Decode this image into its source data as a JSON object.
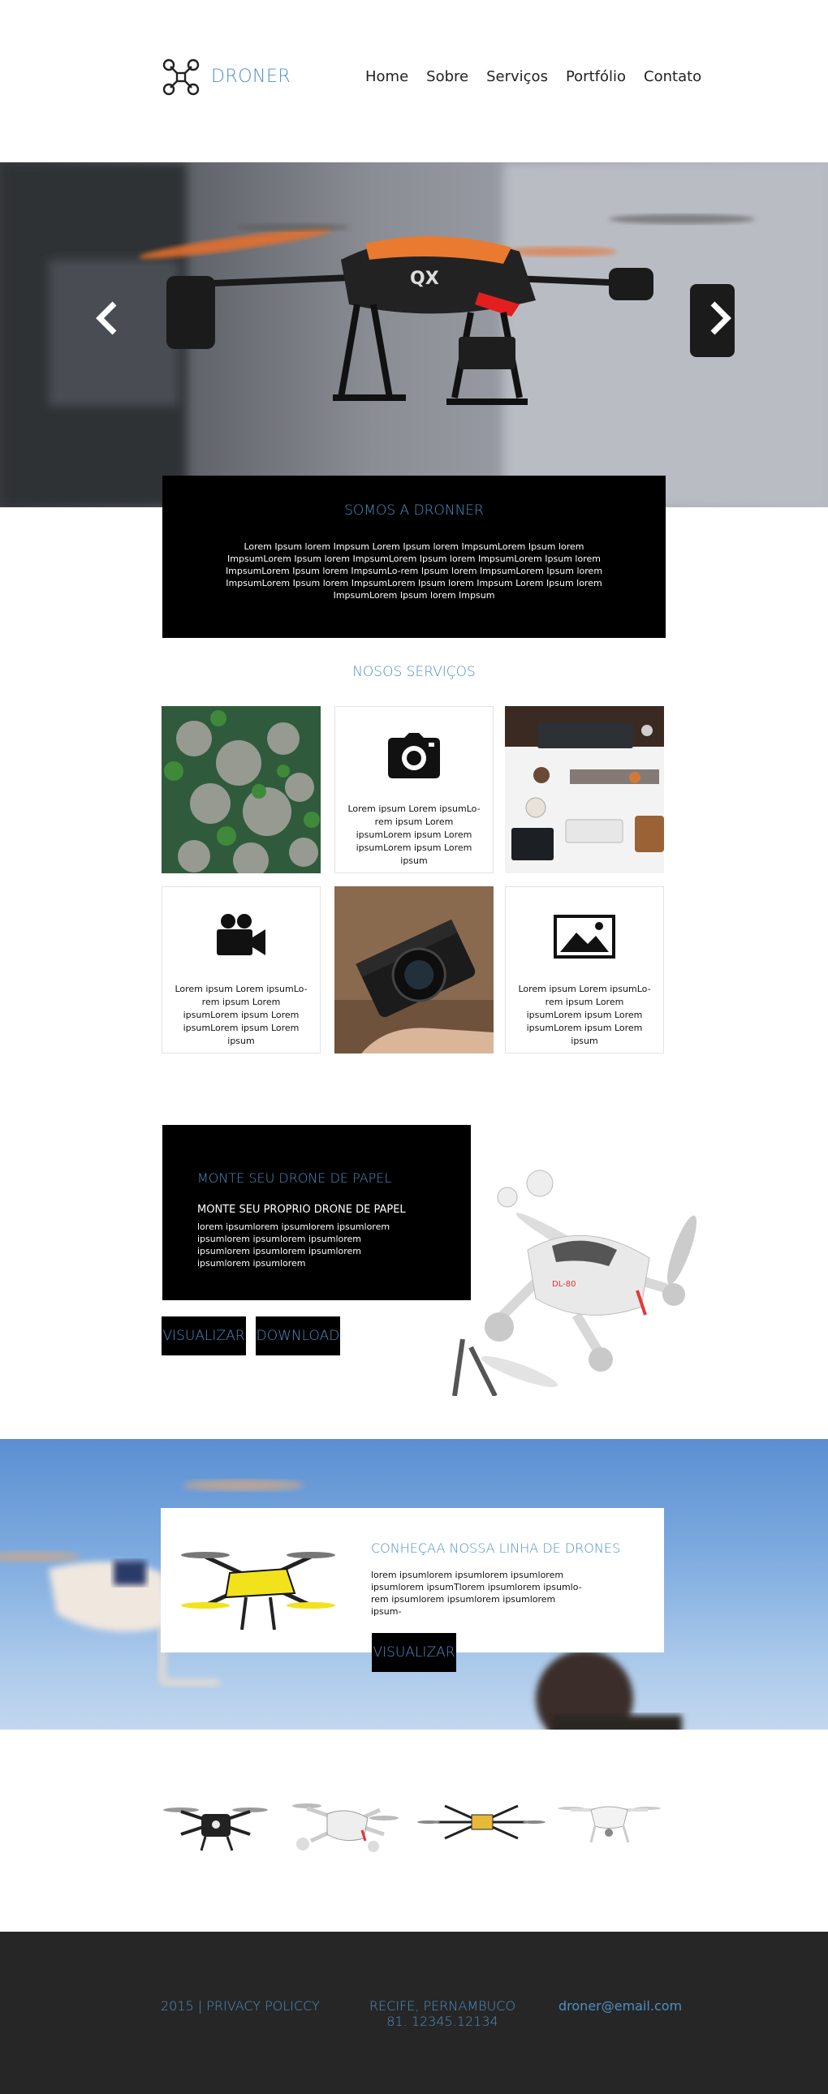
{
  "header": {
    "brand": "DRONER",
    "nav": [
      "Home",
      "Sobre",
      "Serviços",
      "Portfólio",
      "Contato"
    ]
  },
  "about": {
    "title": "SOMOS A DRONNER",
    "text": "Lorem Ipsum lorem Impsum Lorem Ipsum lorem ImpsumLorem Ipsum lorem ImpsumLorem Ipsum lorem ImpsumLorem Ipsum lorem ImpsumLorem Ipsum lorem ImpsumLorem Ipsum lorem ImpsumLo-rem Ipsum lorem ImpsumLorem Ipsum lorem ImpsumLorem Ipsum lorem ImpsumLorem Ipsum lorem Impsum Lorem Ipsum lorem ImpsumLorem Ipsum lorem Impsum"
  },
  "services": {
    "title": "NOSOS SERVIÇOS",
    "tiles": [
      {
        "icon": "camera-icon",
        "text": "Lorem ipsum Lorem ipsumLo-rem ipsum Lorem ipsumLorem ipsum Lorem ipsumLorem ipsum Lorem ipsum"
      },
      {
        "icon": "video-camera-icon",
        "text": "Lorem ipsum Lorem ipsumLo-rem ipsum Lorem ipsumLorem ipsum Lorem ipsumLorem ipsum Lorem ipsum"
      },
      {
        "icon": "image-icon",
        "text": "Lorem ipsum Lorem ipsumLo-rem ipsum Lorem ipsumLorem ipsum Lorem ipsumLorem ipsum Lorem ipsum"
      }
    ]
  },
  "paper": {
    "title": "MONTE SEU DRONE DE PAPEL",
    "subtitle": "MONTE SEU PROPRIO DRONE DE PAPEL",
    "text": "lorem ipsumlorem ipsumlorem ipsumlorem ipsumlorem ipsumlorem ipsumlorem ipsumlorem ipsumlorem ipsumlorem ipsumlorem ipsumlorem",
    "btn_view": "VISUALIZAR",
    "btn_download": "DOWNLOAD"
  },
  "line": {
    "title": "CONHEÇAA NOSSA LINHA DE DRONES",
    "text": "lorem ipsumlorem ipsumlorem ipsumlorem ipsumlorem ipsumTlorem ipsumlorem ipsumlo-rem ipsumlorem ipsumlorem ipsumlorem ipsum-",
    "btn_view": "VISUALIZAR"
  },
  "footer": {
    "left": "2015 | PRIVACY POLICCY",
    "address": "RECIFE, PERNAMBUCO",
    "phone": "81. 12345.12134",
    "email": "droner@email.com"
  },
  "colors": {
    "accent": "#4e8fc4",
    "dark": "#000000",
    "footer_bg": "#262626"
  }
}
